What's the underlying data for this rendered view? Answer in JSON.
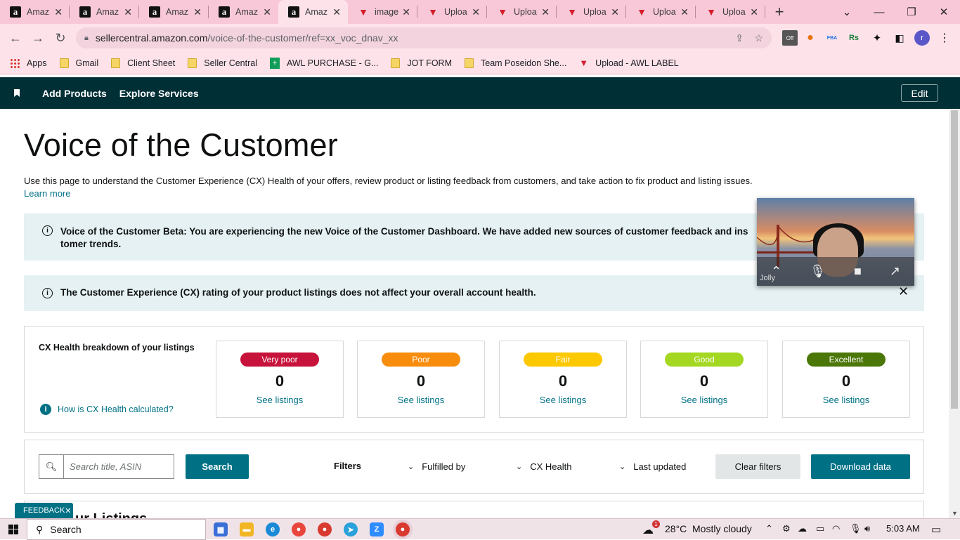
{
  "browser": {
    "tabs": [
      {
        "label": "Amaz",
        "icon": "amazon-icon"
      },
      {
        "label": "Amaz",
        "icon": "amazon-icon"
      },
      {
        "label": "Amaz",
        "icon": "amazon-icon"
      },
      {
        "label": "Amaz",
        "icon": "amazon-icon"
      },
      {
        "label": "Amaz",
        "icon": "amazon-icon",
        "active": true
      },
      {
        "label": "image",
        "icon": "red-v-icon"
      },
      {
        "label": "Uploa",
        "icon": "red-v-icon"
      },
      {
        "label": "Uploa",
        "icon": "red-v-icon"
      },
      {
        "label": "Uploa",
        "icon": "red-v-icon"
      },
      {
        "label": "Uploa",
        "icon": "red-v-icon"
      },
      {
        "label": "Uploa",
        "icon": "red-v-icon"
      }
    ],
    "url_host": "sellercentral.amazon.com",
    "url_path": "/voice-of-the-customer/ref=xx_voc_dnav_xx",
    "extensions": {
      "off_badge": "Off",
      "fba_badge": "FBA",
      "rs_badge": "Rs",
      "profile_initial": "r"
    },
    "bookmarks": [
      "Apps",
      "Gmail",
      "Client Sheet",
      "Seller Central",
      "AWL PURCHASE - G...",
      "JOT FORM",
      "Team Poseidon She...",
      "Upload - AWL LABEL"
    ]
  },
  "nav": {
    "add_products": "Add Products",
    "explore_services": "Explore Services",
    "edit": "Edit"
  },
  "page": {
    "title": "Voice of the Customer",
    "intro": "Use this page to understand the Customer Experience (CX) Health of your offers, review product or listing feedback from customers, and take action to fix product and listing issues.",
    "learn_more": "Learn more",
    "alert_beta": "Voice of the Customer Beta: You are experiencing the new Voice of the Customer Dashboard. We have added new sources of customer feedback and ins",
    "alert_beta_line2": "tomer trends.",
    "alert_rating": "The Customer Experience (CX) rating of your product listings does not affect your overall account health.",
    "close_glyph": "✕"
  },
  "cx": {
    "title": "CX Health breakdown of your listings",
    "how_link": "How is CX Health calculated?",
    "cards": [
      {
        "label": "Very poor",
        "count": "0",
        "link": "See listings",
        "color": "#c7133b"
      },
      {
        "label": "Poor",
        "count": "0",
        "link": "See listings",
        "color": "#f88c0d"
      },
      {
        "label": "Fair",
        "count": "0",
        "link": "See listings",
        "color": "#fcc800"
      },
      {
        "label": "Good",
        "count": "0",
        "link": "See listings",
        "color": "#a4d721"
      },
      {
        "label": "Excellent",
        "count": "0",
        "link": "See listings",
        "color": "#4b7608"
      }
    ]
  },
  "filters": {
    "search_placeholder": "Search title, ASIN",
    "search_button": "Search",
    "label": "Filters",
    "fulfilled_by": "Fulfilled by",
    "cx_health": "CX Health",
    "last_updated": "Last updated",
    "clear": "Clear filters",
    "download": "Download data"
  },
  "listings_partial_title": "ur Listings",
  "feedback": {
    "label": "FEEDBACK",
    "close": "✕"
  },
  "video": {
    "name": "Jolly"
  },
  "taskbar": {
    "search": "Search",
    "weather_temp": "28°C",
    "weather_text": "Mostly cloudy",
    "time": "5:03 AM",
    "weather_badge": "1"
  }
}
